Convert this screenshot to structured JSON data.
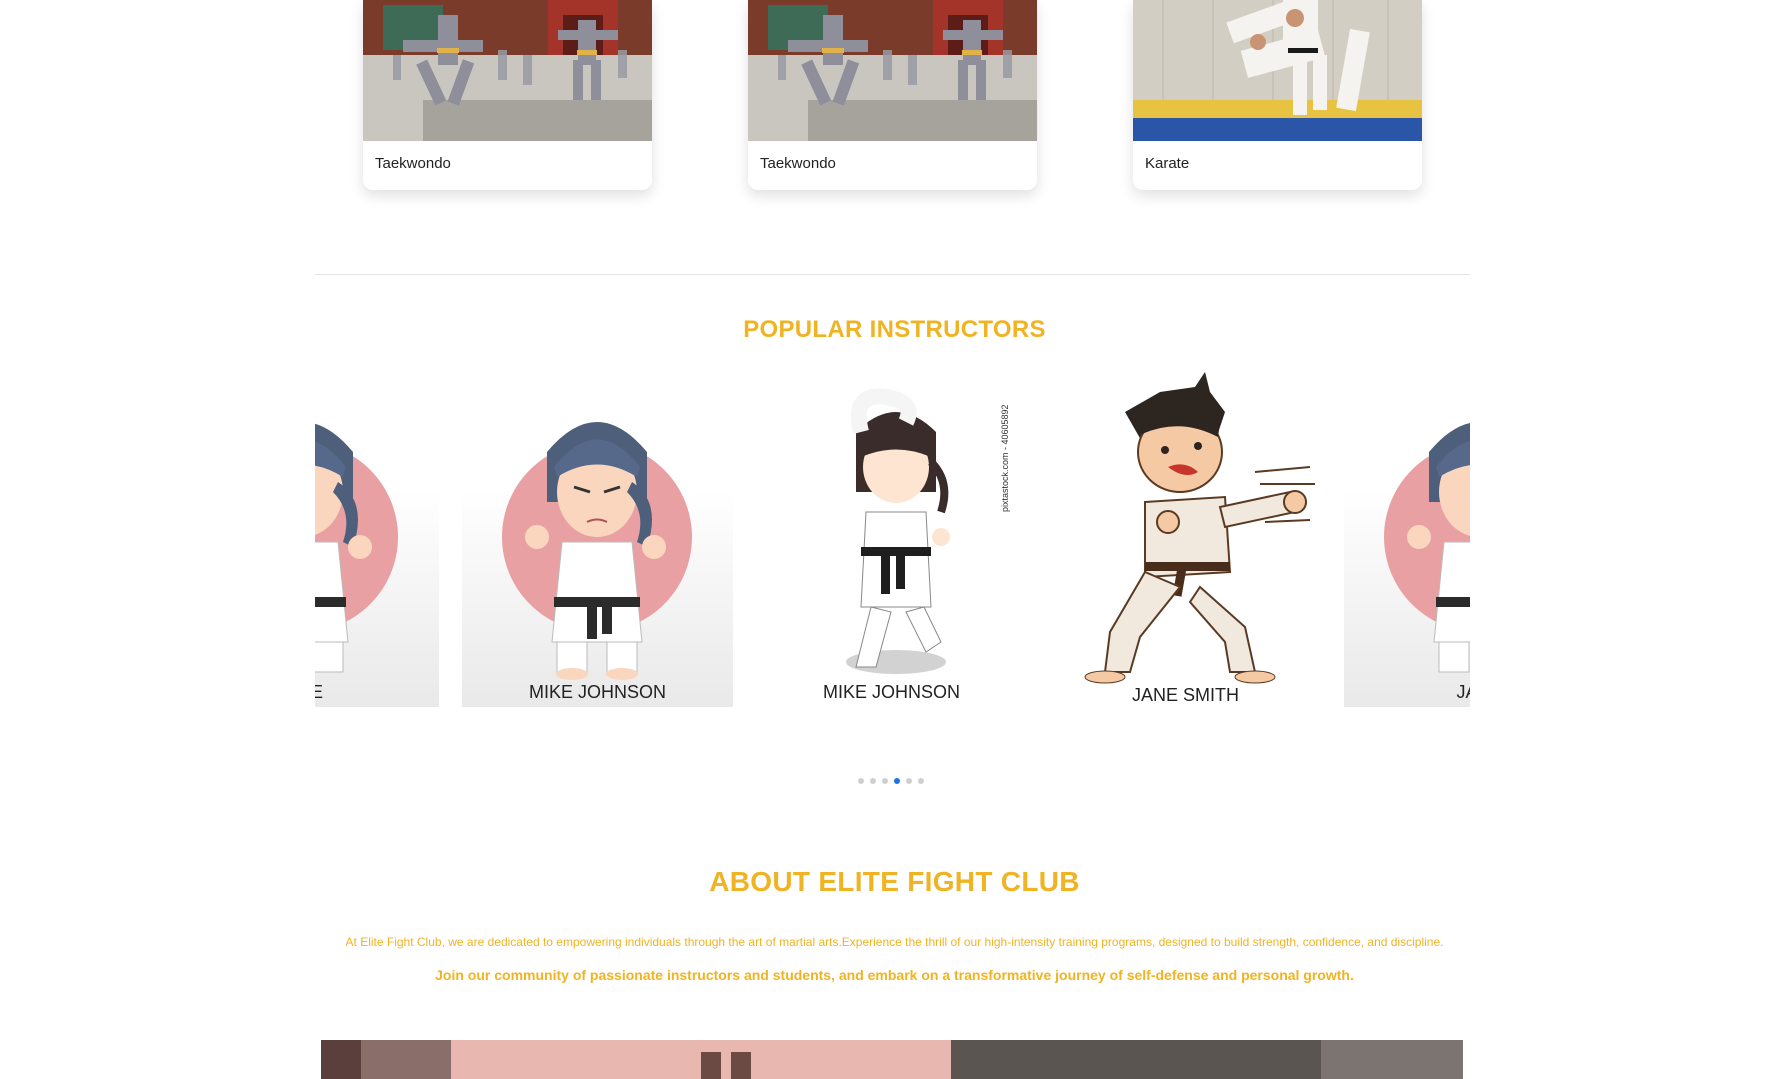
{
  "programs": [
    {
      "label": "Taekwondo",
      "image": "monks-training-photo"
    },
    {
      "label": "Taekwondo",
      "image": "monks-training-photo"
    },
    {
      "label": "Karate",
      "image": "judo-throw-photo"
    }
  ],
  "instructors_section": {
    "title": "POPULAR INSTRUCTORS",
    "slides": [
      {
        "name": "DOE"
      },
      {
        "name": "MIKE JOHNSON"
      },
      {
        "name": "MIKE JOHNSON",
        "watermark": "pixtastock.com - 40605892"
      },
      {
        "name": "JANE SMITH"
      },
      {
        "name": "JANE"
      }
    ],
    "dots_count": 6,
    "active_dot_index": 3
  },
  "about": {
    "title": "ABOUT ELITE FIGHT CLUB",
    "paragraph1": "At Elite Fight Club, we are dedicated to empowering individuals through the art of martial arts.Experience the thrill of our high-intensity training programs, designed to build strength, confidence, and discipline.",
    "paragraph2": "Join our community of passionate instructors and students, and embark on a transformative journey of self-defense and personal growth."
  },
  "colors": {
    "accent": "#f0b323",
    "active_dot": "#1a73e8"
  }
}
